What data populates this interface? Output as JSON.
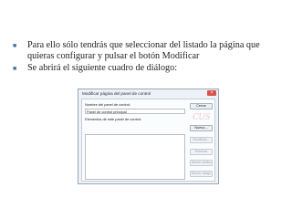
{
  "slide": {
    "bullets": [
      {
        "text": "Para ello sólo tendrás que seleccionar del listado la página que quieras configurar y pulsar el botón Modificar"
      },
      {
        "text": "Se abrirá el siguiente cuadro de diálogo:"
      }
    ],
    "bullet_color": "#3e6fa8"
  },
  "dialog": {
    "title": "Modificar página del panel de control",
    "close_label": "×",
    "name_label": "Nombre del panel de control:",
    "name_value": "Panel de control principal",
    "items_label": "Elementos de este panel de control:",
    "buttons": {
      "close": "Cerrar",
      "new": "Nuevo...",
      "edit": "Modificar...",
      "delete": "Eliminar",
      "move_up": "Mover arriba",
      "move_down": "Mover abajo"
    },
    "watermark_text": "CUS"
  }
}
